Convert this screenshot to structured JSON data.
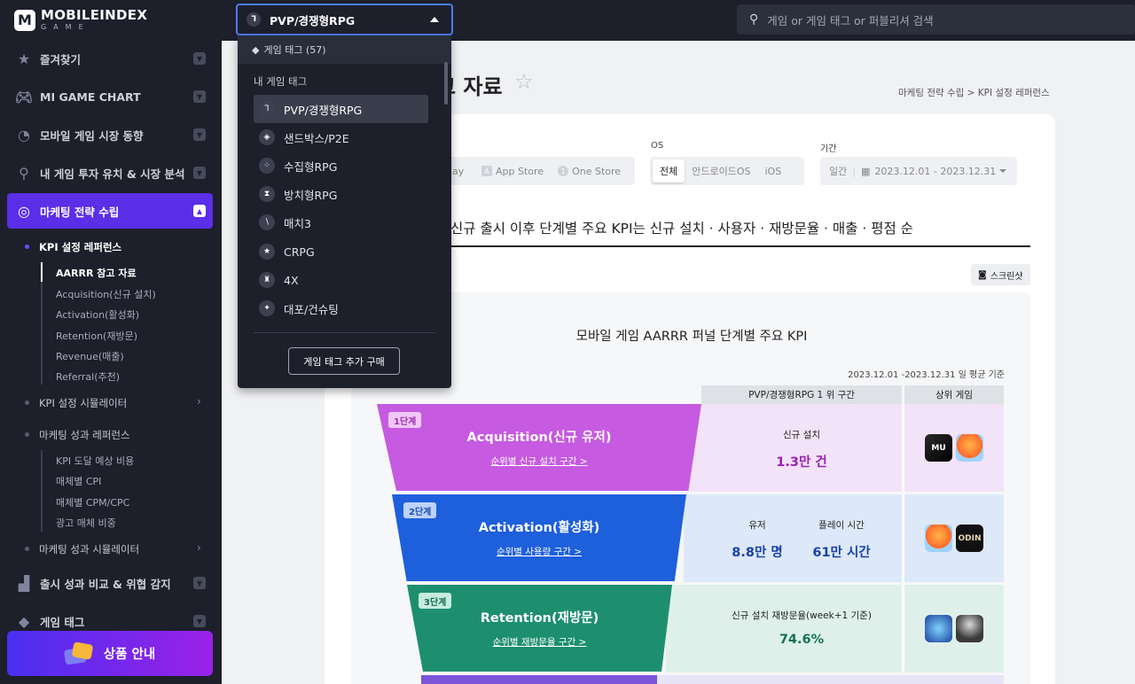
{
  "brand": {
    "name": "MOBILEINDEX",
    "sub": "GAME",
    "mark": "M"
  },
  "sidebar": {
    "nav": [
      {
        "label": "즐겨찾기",
        "icon": "star-icon"
      },
      {
        "label": "MI GAME CHART",
        "icon": "gamepad-icon"
      },
      {
        "label": "모바일 게임 시장 동향",
        "icon": "pie-chart-icon"
      },
      {
        "label": "내 게임 투자 유치 & 시장 분석",
        "icon": "search-chart-icon"
      },
      {
        "label": "마케팅 전략 수립",
        "icon": "target-icon"
      },
      {
        "label": "출시 성과 비교 & 위협 감지",
        "icon": "bar-chart-icon"
      },
      {
        "label": "게임 태그",
        "icon": "tag-icon"
      }
    ],
    "kpi_reference": {
      "label": "KPI 설정 레퍼런스",
      "items": [
        "AARRR 참고 자료",
        "Acquisition(신규 설치)",
        "Activation(활성화)",
        "Retention(재방문)",
        "Revenue(매출)",
        "Referral(추천)"
      ]
    },
    "kpi_simulator": "KPI 설정 시뮬레이터",
    "marketing_reference": {
      "label": "마케팅 성과 레퍼런스",
      "items": [
        "KPI 도달 예상 비용",
        "매체별 CPI",
        "매체별 CPM/CPC",
        "광고 매체 비중"
      ]
    },
    "marketing_simulator": "마케팅 성과 시뮬레이터",
    "product_button": "상품 안내"
  },
  "topbar": {
    "selected_tag": "PVP/경쟁형RPG",
    "search_placeholder": "게임 or 게임 태그 or 퍼블리셔 검색"
  },
  "dropdown": {
    "tag_count": "게임 태그 (57)",
    "my_tags_label": "내 게임 태그",
    "items": [
      "PVP/경쟁형RPG",
      "샌드박스/P2E",
      "수집형RPG",
      "방치형RPG",
      "매치3",
      "CRPG",
      "4X",
      "대포/건슈팅"
    ],
    "buy_button": "게임 태그 추가 구매"
  },
  "main": {
    "title": "고 자료",
    "breadcrumb": "마케팅 전략 수립  >  KPI 설정 레퍼런스",
    "filters": {
      "store_options": [
        "ay",
        "App Store",
        "One Store"
      ],
      "os_label": "OS",
      "os_options": [
        "전체",
        "안드로이드OS",
        "iOS"
      ],
      "period_label": "기간",
      "period_type": "일간",
      "period_value": "2023.12.01 - 2023.12.31"
    },
    "headline": "신규 출시 이후 단계별 주요 KPI는 신규 설치 · 사용자 · 재방문율 · 매출 · 평점 순",
    "screenshot_button": "스크린샷",
    "funnel_title": "모바일 게임 AARRR 퍼널 단계별 주요 KPI",
    "period_note": "2023.12.01 -2023.12.31 일 평균 기준",
    "col_rank": "PVP/경쟁형RPG 1 위 구간",
    "col_top": "상위 게임",
    "stages": [
      {
        "badge": "1단계",
        "title": "Acquisition(신규 유저)",
        "link": "순위별 신규 설치 구간 >",
        "metrics": [
          {
            "label": "신규 설치",
            "value": "1.3만 건"
          }
        ]
      },
      {
        "badge": "2단계",
        "title": "Activation(활성화)",
        "link": "순위별 사용량 구간 >",
        "metrics": [
          {
            "label": "유저",
            "value": "8.8만 명"
          },
          {
            "label": "플레이 시간",
            "value": "61만 시간"
          }
        ]
      },
      {
        "badge": "3단계",
        "title": "Retention(재방문)",
        "link": "순위별 재방문율 구간 >",
        "metrics": [
          {
            "label": "신규 설치 재방문율(week+1 기준)",
            "value": "74.6%"
          }
        ]
      }
    ]
  },
  "colors": {
    "accent": "#5b2ee8",
    "stage1": "#c65ae0",
    "stage2": "#1e5fdc",
    "stage3": "#1d8f6e"
  }
}
